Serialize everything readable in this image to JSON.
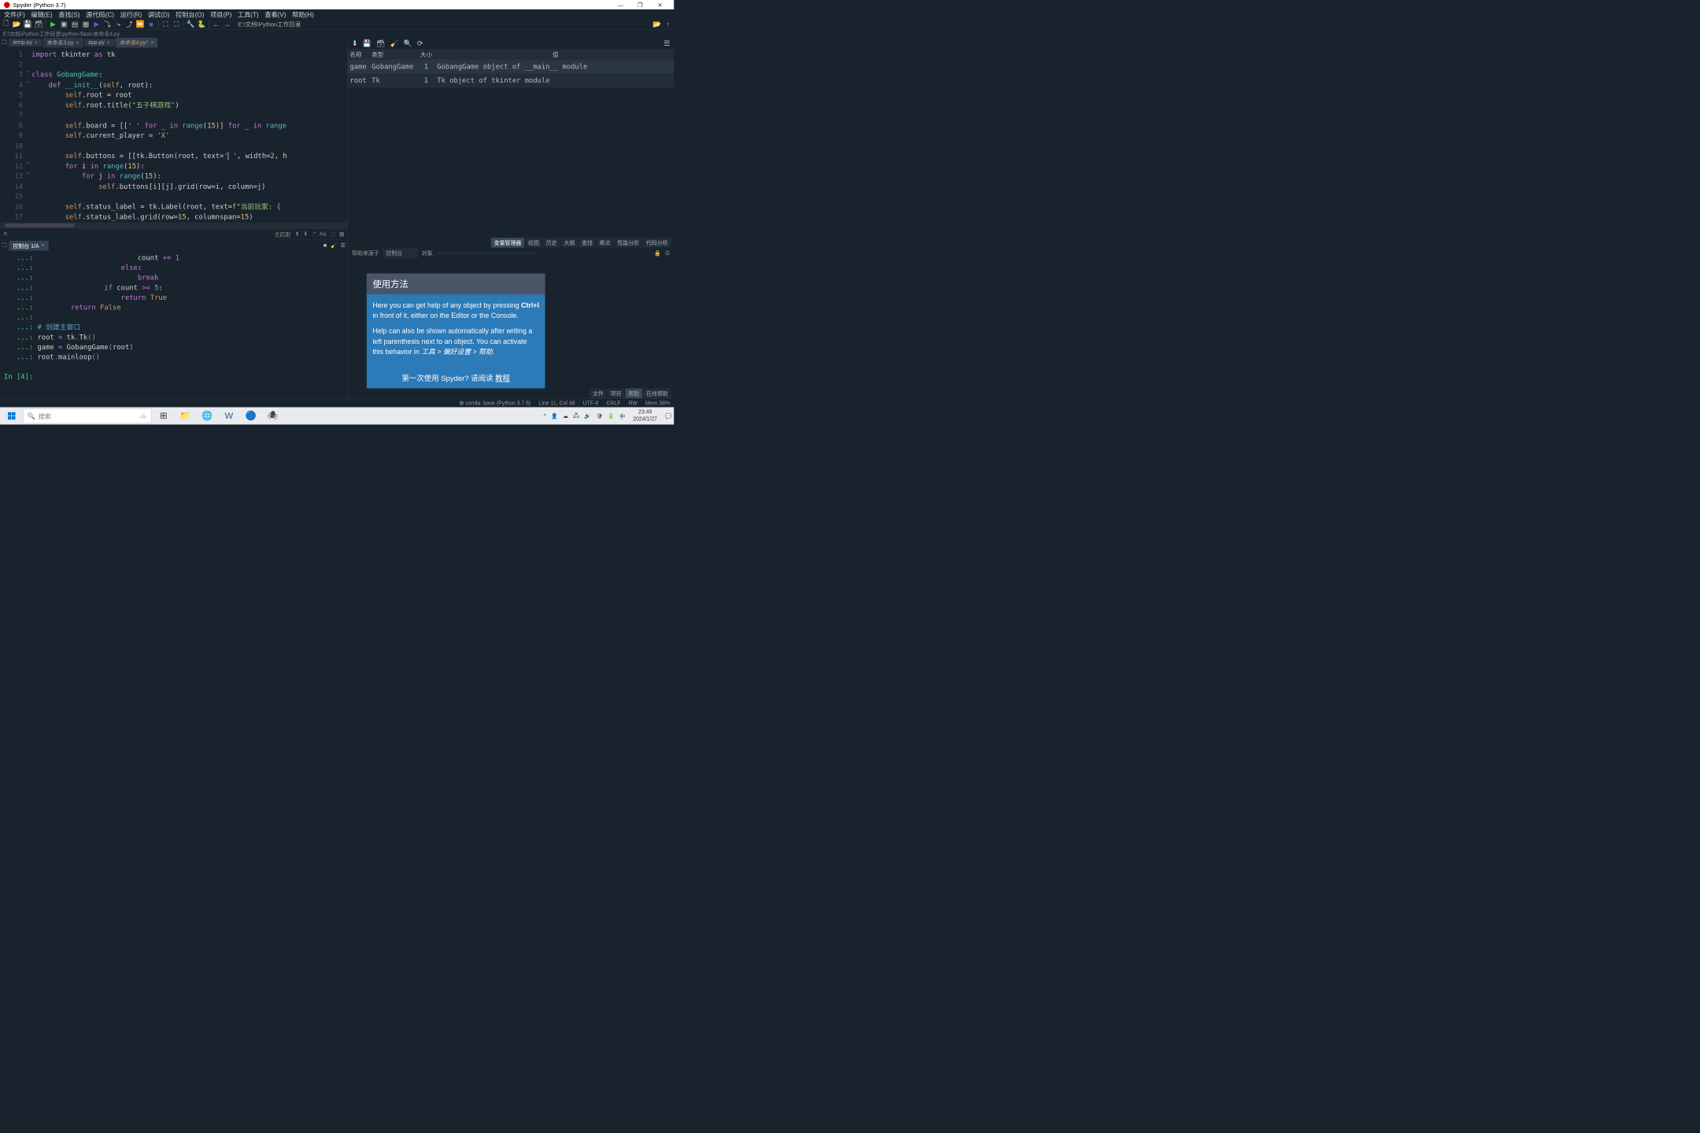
{
  "window": {
    "title": "Spyder (Python 3.7)"
  },
  "menu": [
    "文件(F)",
    "编辑(E)",
    "查找(S)",
    "源代码(C)",
    "运行(R)",
    "调试(D)",
    "控制台(O)",
    "项目(P)",
    "工具(T)",
    "查看(V)",
    "帮助(H)"
  ],
  "toolbar_path": "E:\\文档\\Python工作目录",
  "file_path": "E:\\文档\\Python工作目录\\python-flask\\未命名4.py",
  "editor_tabs": [
    {
      "label": "temp.py",
      "active": false,
      "modified": false
    },
    {
      "label": "未命名3.py",
      "active": false,
      "modified": false
    },
    {
      "label": "app.py",
      "active": false,
      "modified": false
    },
    {
      "label": "未命名4.py*",
      "active": true,
      "modified": true
    }
  ],
  "line_numbers": [
    "1",
    "2",
    "3",
    "4",
    "5",
    "6",
    "7",
    "8",
    "9",
    "10",
    "11",
    "12",
    "13",
    "14",
    "15",
    "16",
    "17"
  ],
  "search_label": "无匹配",
  "console_tab": "控制台 1/A",
  "console_prompt": "In [4]:",
  "var_tools_icons": [
    "download-icon",
    "save-icon",
    "copy-icon",
    "eraser-icon",
    "search-icon",
    "refresh-icon"
  ],
  "var_headers": {
    "name": "名称",
    "type": "类型",
    "size": "大小",
    "value": "值"
  },
  "variables": [
    {
      "name": "game",
      "type": "GobangGame",
      "size": "1",
      "value": "GobangGame object of __main__ module"
    },
    {
      "name": "root",
      "type": "Tk",
      "size": "1",
      "value": "Tk object of tkinter module"
    }
  ],
  "var_tabs": [
    "变量管理器",
    "绘图",
    "历史",
    "大纲",
    "查找",
    "断点",
    "性能分析",
    "代码分析"
  ],
  "help_bar": {
    "source_label": "帮助来源于",
    "source_value": "控制台",
    "object_label": "对象"
  },
  "help": {
    "title": "使用方法",
    "p1a": "Here you can get help of any object by pressing ",
    "p1b": "Ctrl+I",
    "p1c": " in front of it, either on the Editor or the Console.",
    "p2a": "Help can also be shown automatically after writing a left parenthesis next to an object. You can activate this behavior in ",
    "p2b": "工具 > 偏好设置 > 帮助",
    "footer_a": "第一次使用 Spyder? 请阅读 ",
    "footer_link": "教程"
  },
  "help_tabs": [
    "文件",
    "项目",
    "帮助",
    "在线帮助"
  ],
  "status": {
    "env": "conda: base (Python 3.7.6)",
    "pos": "Line 11, Col 48",
    "enc": "UTF-8",
    "eol": "CRLF",
    "mode": "RW",
    "mem": "Mem 38%"
  },
  "taskbar": {
    "search_placeholder": "搜索",
    "time": "23:49",
    "date": "2024/1/27",
    "ime": "中"
  }
}
